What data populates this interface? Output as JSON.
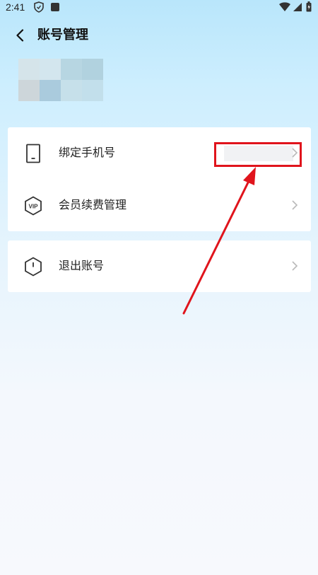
{
  "status_bar": {
    "time": "2:41"
  },
  "header": {
    "title": "账号管理"
  },
  "colors": {
    "accent_red": "#e0141c",
    "background_top": "#b9e6fb"
  },
  "icons": [
    "chevron-left-icon",
    "phone-icon",
    "vip-icon",
    "power-icon",
    "chevron-right-icon",
    "wifi-icon",
    "signal-icon",
    "battery-icon",
    "shield-icon",
    "notification-square-icon"
  ],
  "menu": {
    "card1": [
      {
        "label": "绑定手机号",
        "icon": "phone-icon"
      },
      {
        "label": "会员续费管理",
        "icon": "vip-icon"
      }
    ],
    "card2": [
      {
        "label": "退出账号",
        "icon": "power-icon"
      }
    ]
  },
  "vip_badge": "VIP"
}
